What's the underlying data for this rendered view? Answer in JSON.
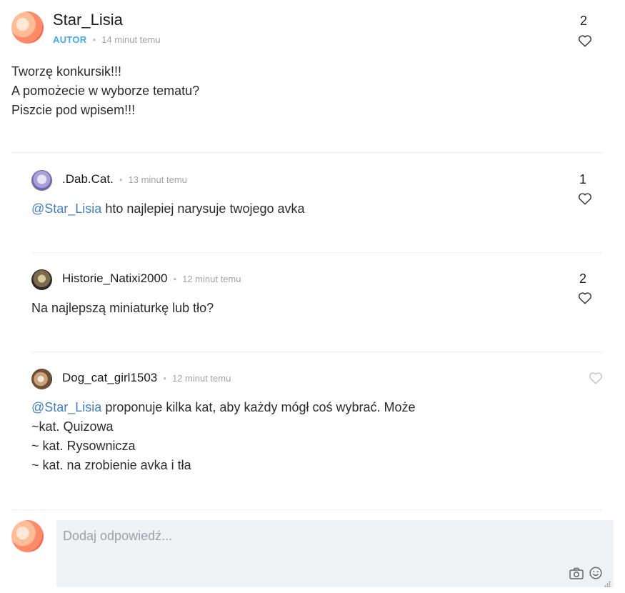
{
  "post": {
    "author": "Star_Lisia",
    "badge": "AUTOR",
    "time": "14 minut temu",
    "likes": "2",
    "lines": [
      "Tworzę konkursik!!!",
      "A pomożecie w wyborze tematu?",
      "Piszcie pod wpisem!!!"
    ]
  },
  "comments": [
    {
      "author": ".Dab.Cat.",
      "time": "13 minut temu",
      "likes": "1",
      "mention": "@Star_Lisia",
      "text": " hto najlepiej narysuje twojego avka"
    },
    {
      "author": "Historie_Natixi2000",
      "time": "12 minut temu",
      "likes": "2",
      "text": "Na najlepszą miniaturkę lub tło?"
    },
    {
      "author": "Dog_cat_girl1503",
      "time": "12 minut temu",
      "likes": "",
      "mention": "@Star_Lisia",
      "line1": " proponuje kilka kat, aby każdy mógł coś wybrać. Może",
      "line2": "~kat. Quizowa",
      "line3": "~ kat. Rysownicza",
      "line4": "~ kat. na zrobienie avka i tła"
    }
  ],
  "reply": {
    "placeholder": "Dodaj odpowiedź..."
  },
  "colors": {
    "accent": "#45a8e8",
    "mention": "#3f7fc2",
    "reply_bg": "#eef2f5"
  },
  "icons": [
    "heart-icon",
    "camera-icon",
    "emoji-icon",
    "resize-handle-icon"
  ]
}
